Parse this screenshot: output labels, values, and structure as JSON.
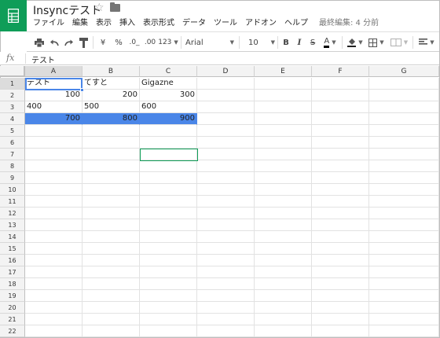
{
  "app": {
    "title": "Insyncテスト",
    "icons": {
      "logo": "sheets-logo-icon",
      "star": "star-outline-icon",
      "folder": "folder-icon"
    },
    "brand_color": "#0f9d58"
  },
  "menu": {
    "items": [
      "ファイル",
      "編集",
      "表示",
      "挿入",
      "表示形式",
      "データ",
      "ツール",
      "アドオン",
      "ヘルプ"
    ],
    "last_edit": "最終編集: 4 分前"
  },
  "toolbar": {
    "currency": "¥",
    "percent": "%",
    "decrease_decimal": ".0_",
    "increase_decimal": ".00",
    "more_formats": "123",
    "font": "Arial",
    "font_size": "10",
    "bold": "B",
    "italic": "I",
    "strikethrough": "S",
    "text_color": "A",
    "icons": [
      "print-icon",
      "undo-icon",
      "redo-icon",
      "paint-format-icon",
      "fill-color-icon",
      "borders-icon",
      "merge-cells-icon",
      "align-icon"
    ]
  },
  "formula_bar": {
    "fx_label": "fx",
    "value": "テスト"
  },
  "grid": {
    "columns": [
      "A",
      "B",
      "C",
      "D",
      "E",
      "F",
      "G"
    ],
    "rows": [
      "1",
      "2",
      "3",
      "4",
      "5",
      "6",
      "7",
      "8",
      "9",
      "10",
      "11",
      "12",
      "13",
      "14",
      "15",
      "16",
      "17",
      "18",
      "19",
      "20",
      "21",
      "22"
    ],
    "cells": {
      "A1": "テスト",
      "B1": "てすと",
      "C1": "Gigazne",
      "A2": "100",
      "B2": "200",
      "C2": "300",
      "A3": "400",
      "B3": "500",
      "C3": "600",
      "A4": "700",
      "B4": "800",
      "C4": "900"
    },
    "highlight_color": "#4a86e8"
  }
}
